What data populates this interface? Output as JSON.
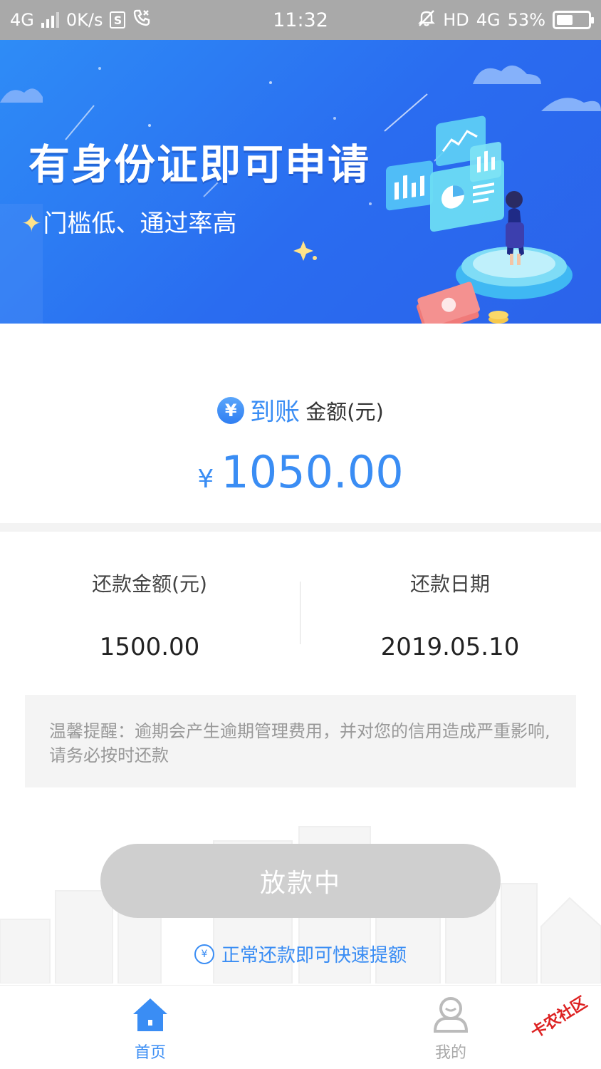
{
  "status_bar": {
    "network": "4G",
    "speed": "0K/s",
    "sim_icon": "S",
    "time": "11:32",
    "hd": "HD",
    "network_right": "4G",
    "battery": "53%",
    "battery_level": 0.53
  },
  "banner": {
    "title": "有身份证即可申请",
    "subtitle": "门槛低、通过率高"
  },
  "amount": {
    "icon": "¥",
    "label_highlight": "到账",
    "label_rest": "金额(元)",
    "currency": "¥",
    "value": "1050.00"
  },
  "repay": {
    "amount_label": "还款金额(元)",
    "amount_value": "1500.00",
    "date_label": "还款日期",
    "date_value": "2019.05.10"
  },
  "notice": {
    "text": "温馨提醒：逾期会产生逾期管理费用，并对您的信用造成严重影响,请务必按时还款"
  },
  "action": {
    "button_label": "放款中",
    "tip_icon": "¥",
    "tip": "正常还款即可快速提额"
  },
  "tabbar": {
    "home_label": "首页",
    "mine_label": "我的"
  },
  "watermark": "卡农社区",
  "colors": {
    "accent": "#3a8df4",
    "banner": "#2a6cf0",
    "button_disabled": "#cfcfcf"
  }
}
